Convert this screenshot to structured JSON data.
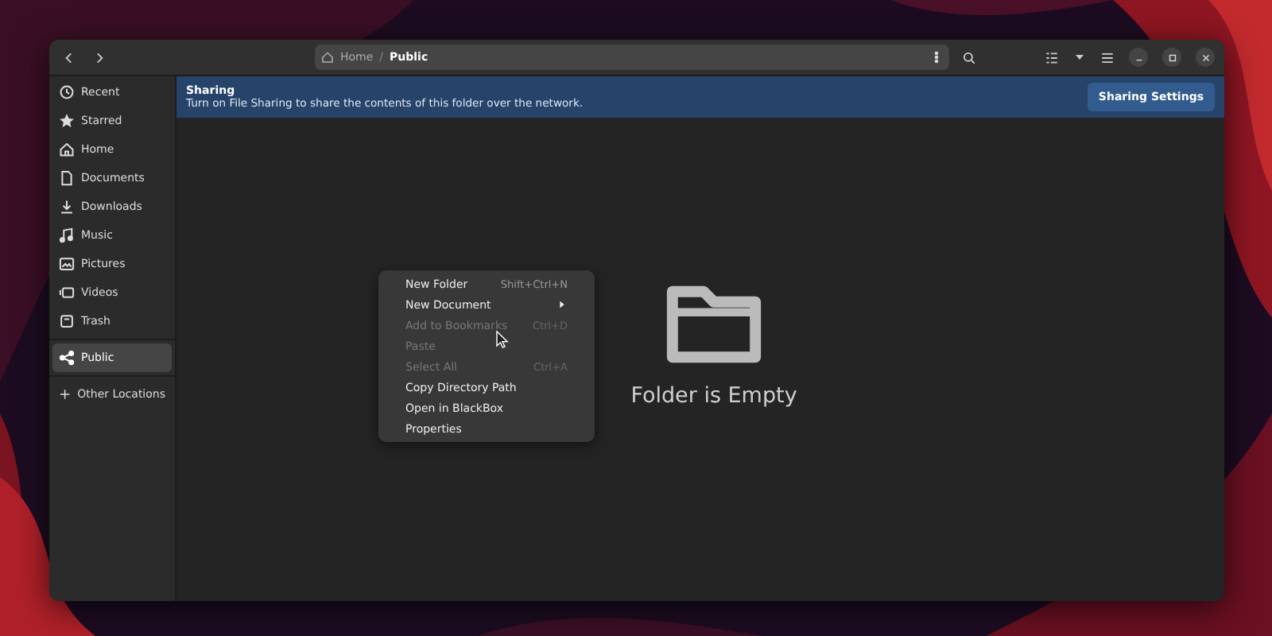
{
  "path": {
    "separator": "/",
    "segments": [
      {
        "label": "Home",
        "selected": false
      },
      {
        "label": "Public",
        "selected": true
      }
    ]
  },
  "sidebar": {
    "items": [
      {
        "label": "Recent",
        "selected": false
      },
      {
        "label": "Starred",
        "selected": false
      },
      {
        "label": "Home",
        "selected": false
      },
      {
        "label": "Documents",
        "selected": false
      },
      {
        "label": "Downloads",
        "selected": false
      },
      {
        "label": "Music",
        "selected": false
      },
      {
        "label": "Pictures",
        "selected": false
      },
      {
        "label": "Videos",
        "selected": false
      },
      {
        "label": "Trash",
        "selected": false
      },
      {
        "label": "Public",
        "selected": true
      },
      {
        "label": "Other Locations",
        "selected": false
      }
    ]
  },
  "banner": {
    "title": "Sharing",
    "message": "Turn on File Sharing to share the contents of this folder over the network.",
    "button": "Sharing Settings"
  },
  "context_menu": {
    "items": [
      {
        "label": "New Folder",
        "shortcut": "Shift+Ctrl+N",
        "disabled": false,
        "kind": "action"
      },
      {
        "label": "New Document",
        "disabled": false,
        "kind": "submenu"
      },
      {
        "label": "Add to Bookmarks",
        "shortcut": "Ctrl+D",
        "disabled": true,
        "kind": "action"
      },
      {
        "label": "Paste",
        "disabled": true,
        "kind": "action"
      },
      {
        "label": "Select All",
        "shortcut": "Ctrl+A",
        "disabled": true,
        "kind": "action"
      },
      {
        "label": "Copy Directory Path",
        "disabled": false,
        "kind": "action"
      },
      {
        "label": "Open in BlackBox",
        "disabled": false,
        "kind": "action"
      },
      {
        "label": "Properties",
        "disabled": false,
        "kind": "action"
      }
    ]
  },
  "empty_state": {
    "message": "Folder is Empty"
  }
}
